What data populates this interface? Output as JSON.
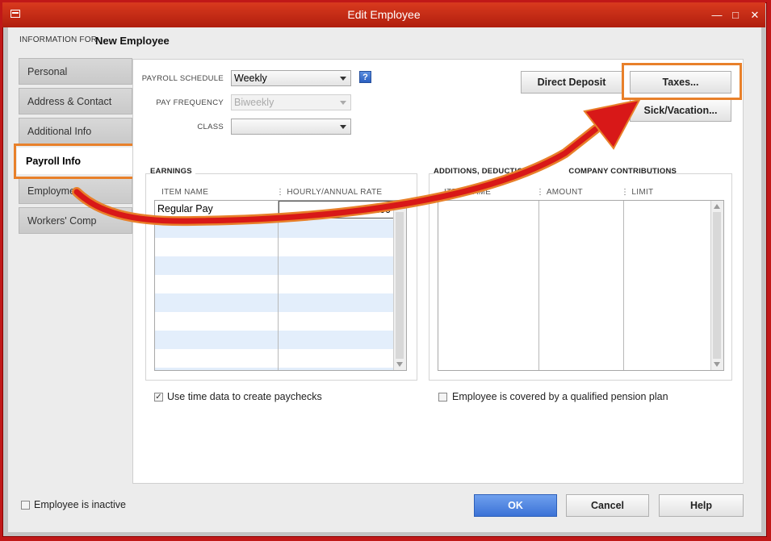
{
  "window": {
    "title": "Edit Employee"
  },
  "header": {
    "info_label": "INFORMATION FOR",
    "employee_name": "New Employee"
  },
  "tabs": [
    "Personal",
    "Address & Contact",
    "Additional Info",
    "Payroll Info",
    "Employment Info",
    "Workers' Comp"
  ],
  "tabs_visible_text": [
    "Personal",
    "Address & Contact",
    "Additional Info",
    "Payroll Info",
    "Employme",
    "Workers' Comp"
  ],
  "active_tab": "Payroll Info",
  "payroll": {
    "schedule_label": "PAYROLL SCHEDULE",
    "schedule_value": "Weekly",
    "frequency_label": "PAY FREQUENCY",
    "frequency_value": "Biweekly",
    "class_label": "CLASS",
    "class_value": "",
    "help_symbol": "?"
  },
  "buttons": {
    "direct_deposit": "Direct Deposit",
    "taxes": "Taxes...",
    "sick_vacation": "Sick/Vacation...",
    "ok": "OK",
    "cancel": "Cancel",
    "help": "Help"
  },
  "earnings": {
    "title": "EARNINGS",
    "columns": [
      "ITEM NAME",
      "HOURLY/ANNUAL RATE"
    ],
    "rows": [
      {
        "item": "Regular Pay",
        "rate": "0.00"
      }
    ]
  },
  "additions": {
    "title": "ADDITIONS, DEDUCTIONS AND COMPANY CONTRIBUTIONS",
    "title_visible": "ADDITIONS, DEDUCTIONS",
    "title_tail": "COMPANY CONTRIBUTIONS",
    "columns": [
      "ITEM NAME",
      "AMOUNT",
      "LIMIT"
    ],
    "columns_visible": [
      "ITEM NAME",
      "AMOUNT",
      "LIMIT"
    ]
  },
  "checkboxes": {
    "use_time_data": {
      "label": "Use time data to create paychecks",
      "checked": true
    },
    "pension_plan": {
      "label": "Employee is covered by a qualified pension plan",
      "checked": false
    },
    "inactive": {
      "label": "Employee is inactive",
      "checked": false
    }
  },
  "colors": {
    "titlebar": "#c9301a",
    "highlight": "#e8802a",
    "arrow": "#d81818",
    "ok_button": "#3b72d6",
    "grid_alt_row": "#e3eefb"
  },
  "icons": {
    "window_menu": "window-menu-icon",
    "minimize": "minimize-icon",
    "maximize": "maximize-icon",
    "close": "close-icon",
    "checkmark": "checkmark-icon"
  }
}
